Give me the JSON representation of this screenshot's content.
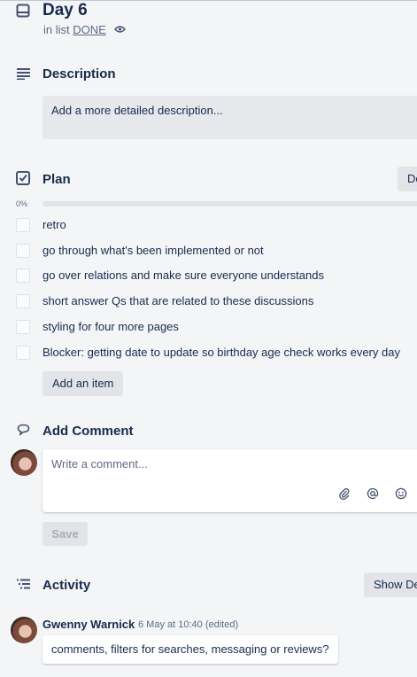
{
  "card": {
    "title": "Day 6",
    "in_list_prefix": "in list",
    "list_name": "DONE"
  },
  "description": {
    "heading": "Description",
    "placeholder": "Add a more detailed description..."
  },
  "checklist": {
    "heading": "Plan",
    "delete_label": "Delete",
    "progress_label": "0%",
    "progress": 0,
    "items": [
      {
        "label": "retro",
        "checked": false
      },
      {
        "label": "go through what's been implemented or not",
        "checked": false
      },
      {
        "label": "go over relations and make sure everyone understands",
        "checked": false
      },
      {
        "label": "short answer Qs that are related to these discussions",
        "checked": false
      },
      {
        "label": "styling for four more pages",
        "checked": false
      },
      {
        "label": "Blocker: getting date to update so birthday age check works every day",
        "checked": false
      }
    ],
    "add_item_label": "Add an item"
  },
  "add_comment": {
    "heading": "Add Comment",
    "placeholder": "Write a comment...",
    "save_label": "Save"
  },
  "activity": {
    "heading": "Activity",
    "show_details_label": "Show Details",
    "entries": [
      {
        "author": "Gwenny Warnick",
        "meta": "6 May at 10:40 (edited)",
        "text": "comments, filters for searches, messaging or reviews?"
      }
    ]
  },
  "colors": {
    "text": "#172b4d",
    "muted": "#5e6c84",
    "background": "#f4f5f7",
    "button": "#e2e4e8"
  }
}
